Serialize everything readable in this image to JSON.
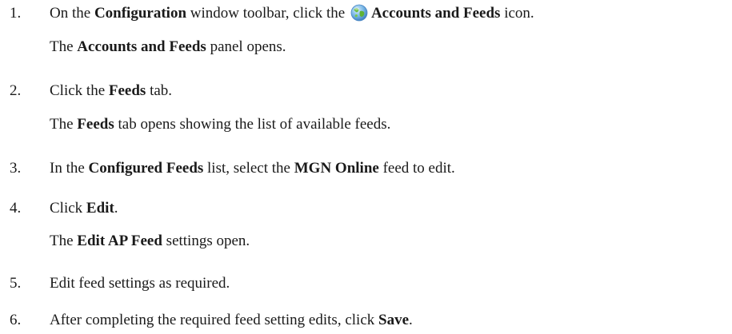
{
  "steps": [
    {
      "number": "1.",
      "a": "On the ",
      "b1": "Configuration",
      "c": " window toolbar, click the ",
      "icon": "accounts-and-feeds-globe-icon",
      "b2": "Accounts and Feeds",
      "d": " icon.",
      "result": {
        "a": "The ",
        "b": "Accounts and Feeds",
        "c": " panel opens."
      }
    },
    {
      "number": "2.",
      "a": "Click the ",
      "b1": "Feeds",
      "c": " tab.",
      "result": {
        "a": "The ",
        "b": "Feeds",
        "c": " tab opens showing the list of available feeds."
      }
    },
    {
      "number": "3.",
      "a": "In the ",
      "b1": "Configured Feeds",
      "c": " list, select the ",
      "b2": "MGN Online",
      "d": " feed to edit."
    },
    {
      "number": "4.",
      "a": "Click ",
      "b1": "Edit",
      "c": ".",
      "result": {
        "a": "The ",
        "b": "Edit AP Feed",
        "c": " settings open."
      }
    },
    {
      "number": "5.",
      "a": "Edit feed settings as required."
    },
    {
      "number": "6.",
      "a": "After completing the required feed setting edits, click ",
      "b1": "Save",
      "c": "."
    }
  ]
}
